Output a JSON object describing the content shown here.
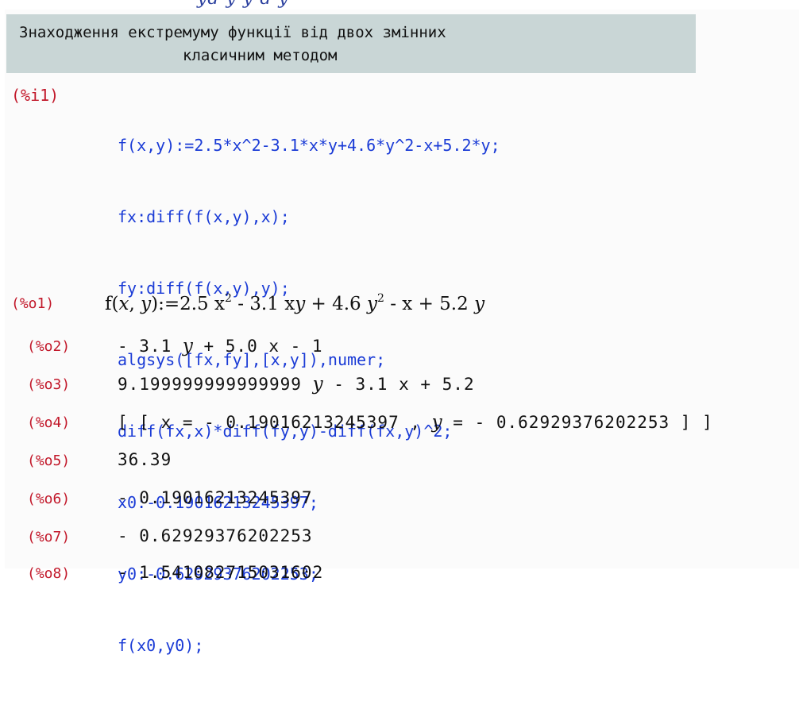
{
  "top_fragment": "yd  y y d y",
  "title_cell": {
    "line1": "Знаходження екстремуму функції від двох змінних",
    "line2": "класичним методом"
  },
  "input": {
    "label": "(%i1)",
    "lines": [
      "f(x,y):=2.5*x^2-3.1*x*y+4.6*y^2-x+5.2*y;",
      "fx:diff(f(x,y),x);",
      "fy:diff(f(x,y),y);",
      "algsys([fx,fy],[x,y]),numer;",
      "diff(fx,x)*diff(fy,y)-diff(fx,y)^2;",
      "x0:-0.19016213245397;",
      "y0:-0.62929376202253;",
      "f(x0,y0);"
    ]
  },
  "outputs": [
    {
      "label": "(%o1)",
      "parts": [
        "f(",
        "x",
        ", ",
        "y",
        "):=2.5 ",
        "x",
        "2",
        " - 3.1 ",
        "x",
        "y",
        " + 4.6 ",
        "y",
        "2",
        " - x + 5.2 ",
        "y"
      ]
    },
    {
      "label": "(%o2)",
      "parts": [
        "- 3.1 ",
        "y",
        " + 5.0 x - 1"
      ]
    },
    {
      "label": "(%o3)",
      "parts": [
        "9.199999999999999 ",
        "y",
        " - 3.1 x + 5.2"
      ]
    },
    {
      "label": "(%o4)",
      "parts": [
        "[ [ x = - 0.19016213245397 , ",
        "y",
        " = - 0.62929376202253 ] ]"
      ]
    },
    {
      "label": "(%o5)",
      "value": "36.39"
    },
    {
      "label": "(%o6)",
      "value": "- 0.19016213245397"
    },
    {
      "label": "(%o7)",
      "value": "- 0.62929376202253"
    },
    {
      "label": "(%o8)",
      "value": "- 1.541082715031602"
    }
  ]
}
